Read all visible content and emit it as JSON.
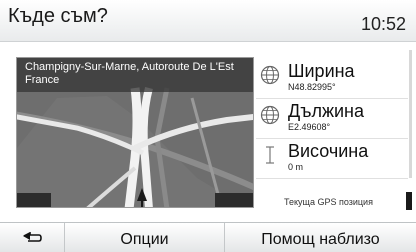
{
  "header": {
    "title": "Къде съм?",
    "time": "10:52"
  },
  "map": {
    "address_line1": "Champigny-Sur-Marne, Autoroute De L'Est",
    "address_line2": "France"
  },
  "info": [
    {
      "label": "Ширина",
      "value": "N48.82995°",
      "icon": "globe-icon"
    },
    {
      "label": "Дължина",
      "value": "E2.49608°",
      "icon": "globe-icon"
    },
    {
      "label": "Височина",
      "value": "0 m",
      "icon": "altitude-icon"
    }
  ],
  "gps_label": "Текуща GPS позиция",
  "toolbar": {
    "back_icon": "back-arrow-icon",
    "options_label": "Опции",
    "nearby_label": "Помощ наблизо"
  }
}
